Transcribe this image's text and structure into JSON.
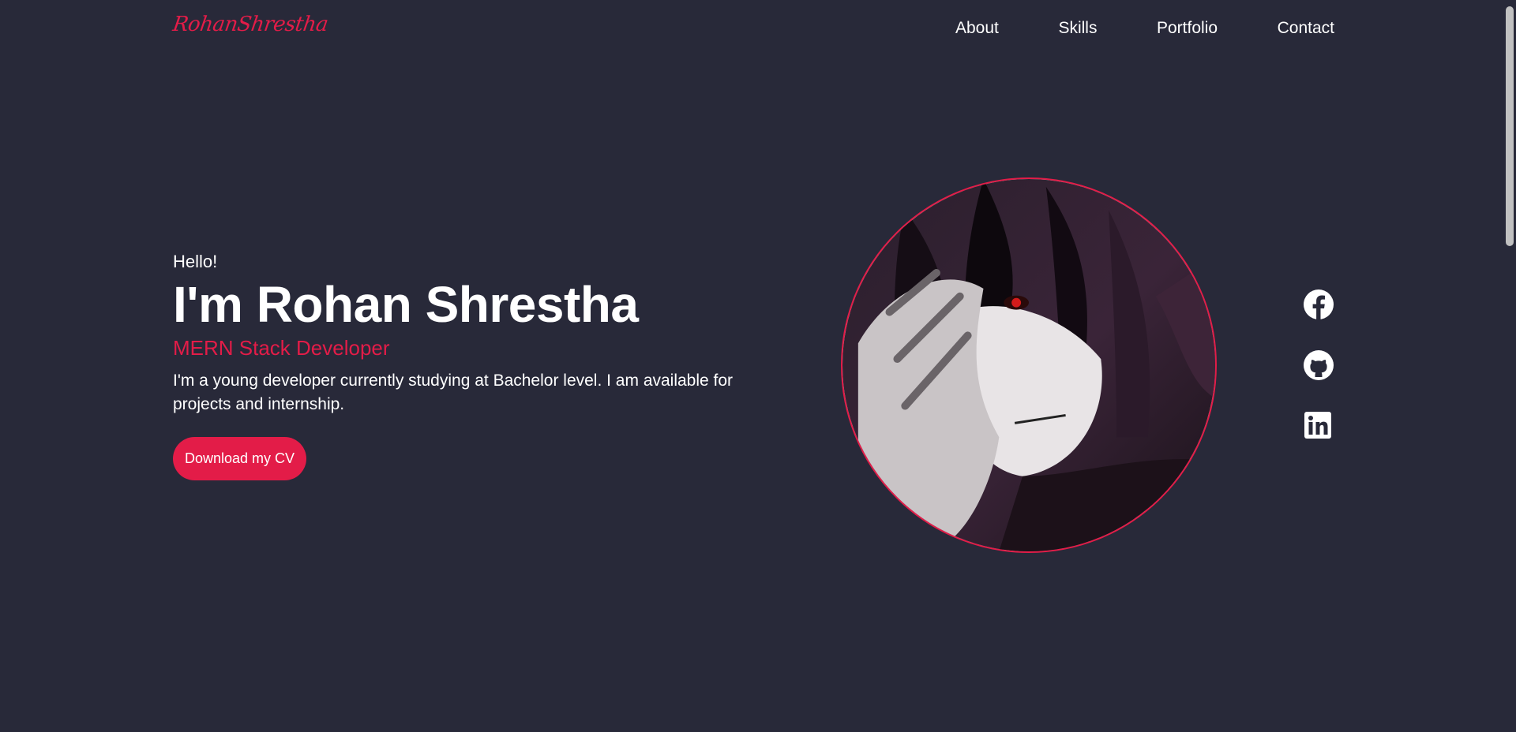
{
  "header": {
    "logo": "RohanShrestha",
    "nav": [
      "About",
      "Skills",
      "Portfolio",
      "Contact"
    ]
  },
  "hero": {
    "greeting": "Hello!",
    "name": "I'm Rohan Shrestha",
    "role": "MERN Stack Developer",
    "description": "I'm a young developer currently studying at Bachelor level. I am available for projects and internship.",
    "cta": "Download my CV"
  },
  "social": {
    "icons": [
      "facebook-icon",
      "github-icon",
      "linkedin-icon"
    ]
  },
  "colors": {
    "background": "#282939",
    "accent": "#e31c48",
    "text": "#ffffff"
  }
}
